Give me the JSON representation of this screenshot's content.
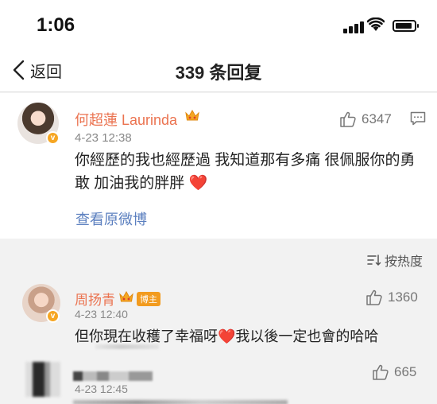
{
  "status_bar": {
    "time": "1:06"
  },
  "navbar": {
    "back_label": "返回",
    "title": "339 条回复"
  },
  "main_comment": {
    "username": "何超蓮 Laurinda",
    "timestamp": "4-23 12:38",
    "likes": "6347",
    "text": "你經歷的我也經歷過 我知道那有多痛 很佩服你的勇敢 加油我的胖胖",
    "heart": "❤️",
    "view_original": "查看原微博"
  },
  "sort": {
    "label": "按热度"
  },
  "replies": [
    {
      "username": "周扬青",
      "tag": "博主",
      "timestamp": "4-23 12:40",
      "likes": "1360",
      "text_before": "但你現在收穫了幸福呀",
      "heart": "❤️",
      "text_after": "我以後一定也會的哈哈"
    },
    {
      "timestamp": "4-23 12:45",
      "likes": "665"
    }
  ],
  "colors": {
    "username": "#eb7350",
    "link": "#5b7fbf",
    "verified_badge": "#f6a623",
    "background": "#f2f2f2"
  },
  "icons": [
    "back-chevron-icon",
    "thumbs-up-icon",
    "comment-icon",
    "sort-icon",
    "crown-icon",
    "verified-icon",
    "wifi-icon",
    "signal-icon",
    "battery-icon"
  ]
}
